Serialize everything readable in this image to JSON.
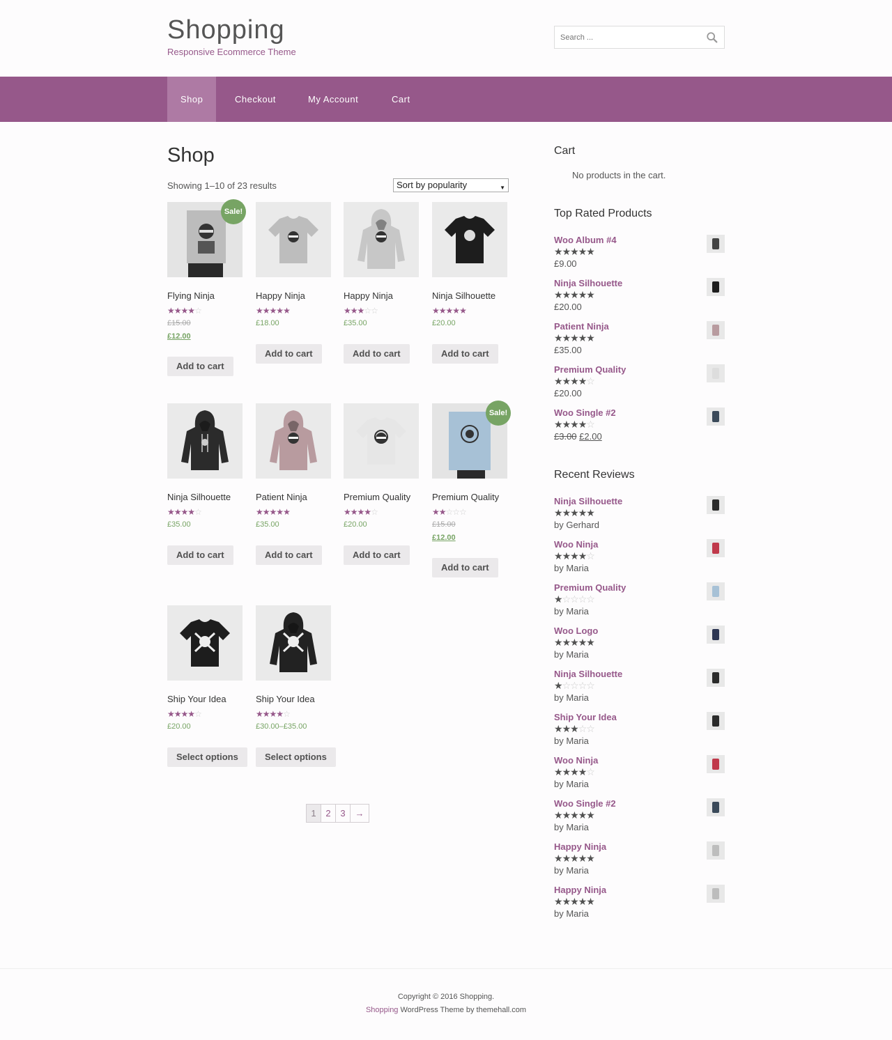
{
  "site": {
    "title": "Shopping",
    "tagline": "Responsive Ecommerce Theme",
    "accent": "#96588a"
  },
  "search": {
    "placeholder": "Search ..."
  },
  "nav": {
    "items": [
      "Shop",
      "Checkout",
      "My Account",
      "Cart"
    ],
    "active": "Shop"
  },
  "shop": {
    "title": "Shop",
    "result_count": "Showing 1–10 of 23 results",
    "sort_value": "Sort by popularity",
    "sale_badge": "Sale!",
    "products": [
      {
        "title": "Flying Ninja",
        "rating": 4,
        "price_old": "£15.00",
        "price": "£12.00",
        "sale": true,
        "button": "Add to cart",
        "image": "poster-ninja"
      },
      {
        "title": "Happy Ninja",
        "rating": 5,
        "price": "£18.00",
        "button": "Add to cart",
        "image": "grey-tshirt"
      },
      {
        "title": "Happy Ninja",
        "rating": 3,
        "price": "£35.00",
        "button": "Add to cart",
        "image": "grey-hoodie"
      },
      {
        "title": "Ninja Silhouette",
        "rating": 5,
        "price": "£20.00",
        "button": "Add to cart",
        "image": "black-tshirt"
      },
      {
        "title": "Ninja Silhouette",
        "rating": 4,
        "price": "£35.00",
        "button": "Add to cart",
        "image": "black-hoodie"
      },
      {
        "title": "Patient Ninja",
        "rating": 5,
        "price": "£35.00",
        "button": "Add to cart",
        "image": "pink-hoodie"
      },
      {
        "title": "Premium Quality",
        "rating": 4.5,
        "price": "£20.00",
        "button": "Add to cart",
        "image": "white-tshirt"
      },
      {
        "title": "Premium Quality",
        "rating": 2,
        "price_old": "£15.00",
        "price": "£12.00",
        "sale": true,
        "button": "Add to cart",
        "image": "poster-blue"
      },
      {
        "title": "Ship Your Idea",
        "rating": 4.5,
        "price": "£20.00",
        "button": "Select options",
        "image": "black-tshirt-skull"
      },
      {
        "title": "Ship Your Idea",
        "rating": 4,
        "price": "£30.00–£35.00",
        "button": "Select options",
        "image": "black-hoodie-skull"
      }
    ]
  },
  "pagination": {
    "pages": [
      "1",
      "2",
      "3"
    ],
    "current": "1",
    "next": "→"
  },
  "sidebar": {
    "cart_title": "Cart",
    "cart_empty": "No products in the cart.",
    "top_rated_title": "Top Rated Products",
    "top_rated": [
      {
        "title": "Woo Album #4",
        "rating": 5,
        "price": "£9.00",
        "thumb": "album"
      },
      {
        "title": "Ninja Silhouette",
        "rating": 5,
        "price": "£20.00",
        "thumb": "black-tshirt"
      },
      {
        "title": "Patient Ninja",
        "rating": 5,
        "price": "£35.00",
        "thumb": "pink-hoodie"
      },
      {
        "title": "Premium Quality",
        "rating": 4.5,
        "price": "£20.00",
        "thumb": "white-tshirt"
      },
      {
        "title": "Woo Single #2",
        "rating": 4.5,
        "price_old": "£3.00",
        "price": "£2.00",
        "thumb": "single"
      }
    ],
    "reviews_title": "Recent Reviews",
    "reviews": [
      {
        "title": "Ninja Silhouette",
        "rating": 5,
        "by": "by Gerhard",
        "thumb": "black-hoodie"
      },
      {
        "title": "Woo Ninja",
        "rating": 4,
        "by": "by Maria",
        "thumb": "red-tshirt"
      },
      {
        "title": "Premium Quality",
        "rating": 1,
        "by": "by Maria",
        "thumb": "poster-blue"
      },
      {
        "title": "Woo Logo",
        "rating": 5,
        "by": "by Maria",
        "thumb": "navy-hoodie"
      },
      {
        "title": "Ninja Silhouette",
        "rating": 1,
        "by": "by Maria",
        "thumb": "black-hoodie"
      },
      {
        "title": "Ship Your Idea",
        "rating": 3,
        "by": "by Maria",
        "thumb": "black-hoodie"
      },
      {
        "title": "Woo Ninja",
        "rating": 4,
        "by": "by Maria",
        "thumb": "red-hoodie"
      },
      {
        "title": "Woo Single #2",
        "rating": 5,
        "by": "by Maria",
        "thumb": "single"
      },
      {
        "title": "Happy Ninja",
        "rating": 5,
        "by": "by Maria",
        "thumb": "grey-hoodie"
      },
      {
        "title": "Happy Ninja",
        "rating": 5,
        "by": "by Maria",
        "thumb": "grey-tshirt"
      }
    ]
  },
  "footer": {
    "copyright": "Copyright © 2016 Shopping.",
    "credit_brand": "Shopping",
    "credit_rest": " WordPress Theme by themehall.com"
  }
}
